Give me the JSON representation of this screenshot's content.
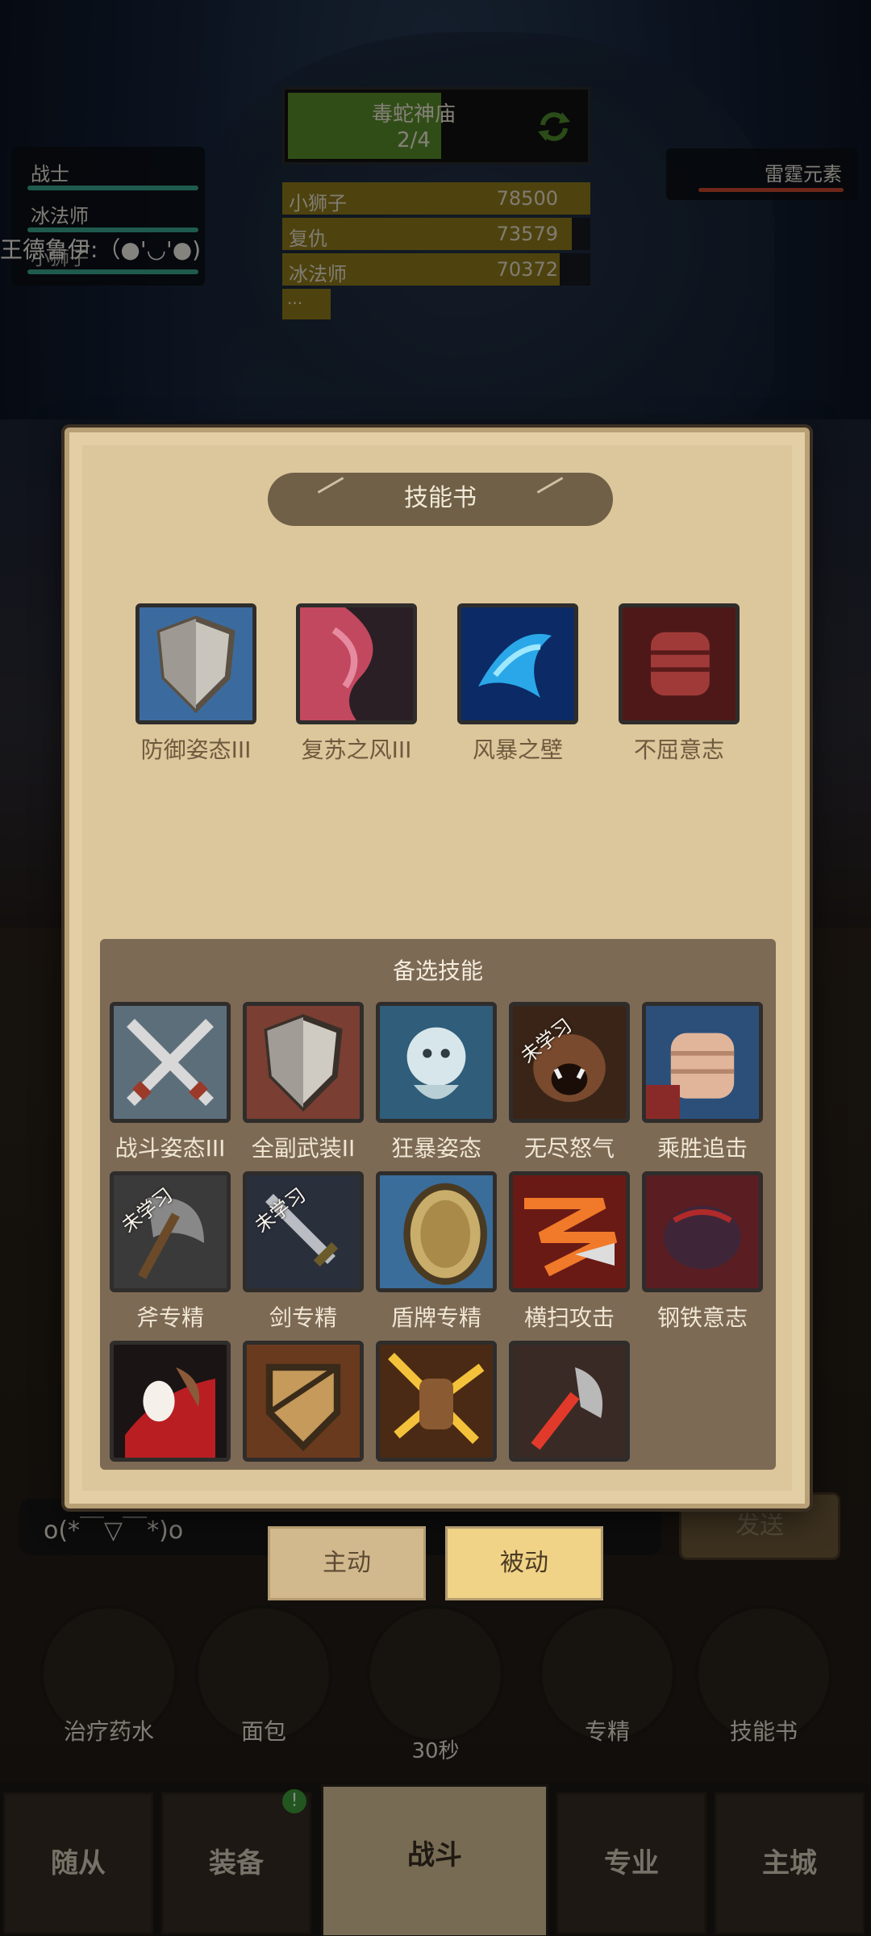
{
  "hud": {
    "party": [
      "战士",
      "冰法师",
      "小狮子"
    ],
    "party_overlay_text": "王德鲁伊:（●'◡'●)",
    "enemy_name": "雷霆元素",
    "dungeon": {
      "name": "毒蛇神庙",
      "progress": "2/4"
    },
    "damage": [
      {
        "name": "小狮子",
        "value": "78500",
        "fill_pct": 100
      },
      {
        "name": "复仇",
        "value": "73579",
        "fill_pct": 94
      },
      {
        "name": "冰法师",
        "value": "70372",
        "fill_pct": 90
      }
    ],
    "damage_more": "..."
  },
  "modal": {
    "title": "技能书",
    "equipped_skills": [
      {
        "label": "防御姿态III",
        "icon": "shield-icon"
      },
      {
        "label": "复苏之风III",
        "icon": "wind-icon"
      },
      {
        "label": "风暴之壁",
        "icon": "storm-icon"
      },
      {
        "label": "不屈意志",
        "icon": "fist-icon"
      }
    ],
    "candidate_title": "备选技能",
    "unlearned_text": "未学习",
    "candidate_skills": [
      {
        "label": "战斗姿态III",
        "icon": "crossed-swords-icon",
        "unlearned": false
      },
      {
        "label": "全副武装II",
        "icon": "shield-icon",
        "unlearned": false
      },
      {
        "label": "狂暴姿态",
        "icon": "berserker-icon",
        "unlearned": false
      },
      {
        "label": "无尽怒气",
        "icon": "roar-icon",
        "unlearned": true
      },
      {
        "label": "乘胜追击",
        "icon": "fist-icon",
        "unlearned": false
      },
      {
        "label": "斧专精",
        "icon": "axe-icon",
        "unlearned": true
      },
      {
        "label": "剑专精",
        "icon": "sword-icon",
        "unlearned": true
      },
      {
        "label": "盾牌专精",
        "icon": "round-shield-icon",
        "unlearned": false
      },
      {
        "label": "横扫攻击",
        "icon": "sweep-icon",
        "unlearned": false
      },
      {
        "label": "钢铁意志",
        "icon": "muscle-icon",
        "unlearned": false
      },
      {
        "label": "",
        "icon": "blood-strike-icon",
        "unlearned": false
      },
      {
        "label": "",
        "icon": "guard-icon",
        "unlearned": false
      },
      {
        "label": "",
        "icon": "smash-icon",
        "unlearned": false
      },
      {
        "label": "",
        "icon": "slash-icon",
        "unlearned": false
      }
    ]
  },
  "chat": {
    "input_value": "o(*￣▽￣*)o",
    "send_label": "发送"
  },
  "mode_tabs": {
    "active": "主动",
    "passive": "被动",
    "selected": "被动"
  },
  "quick_slots": [
    "治疗药水",
    "面包",
    "",
    "专精",
    "技能书"
  ],
  "chest_timer": "30秒",
  "nav": [
    "随从",
    "装备",
    "战斗",
    "专业",
    "主城"
  ],
  "nav_badge": "!",
  "colors": {
    "accent": "#f0d386",
    "panel": "#dcc69b",
    "candidate_bg": "#7d6a55"
  }
}
